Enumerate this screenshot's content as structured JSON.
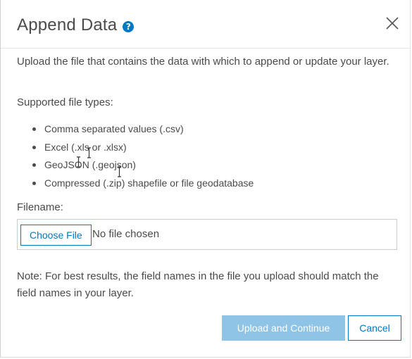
{
  "dialog": {
    "title": "Append Data",
    "help_icon": "question-circle-icon",
    "close_icon": "close-icon"
  },
  "intro_text": "Upload the file that contains the data with which to append or update your layer.",
  "supported_label": "Supported file types:",
  "file_types": [
    "Comma separated values (.csv)",
    "Excel (.xls or .xlsx)",
    "GeoJSON (.geojson)",
    "Compressed (.zip) shapefile or file geodatabase"
  ],
  "filename_label": "Filename:",
  "file_input": {
    "button_label": "Choose File",
    "status": "No file chosen"
  },
  "note": "Note: For best results, the field names in the file you upload should match the field names in your layer.",
  "buttons": {
    "primary": "Upload and Continue",
    "cancel": "Cancel"
  },
  "colors": {
    "accent": "#0079c1",
    "primary_disabled": "#8fc4e6",
    "text": "#4a4a4a"
  }
}
